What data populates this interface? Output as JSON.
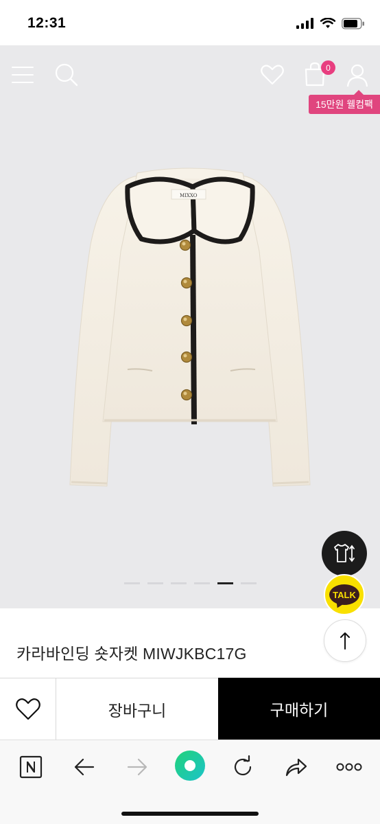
{
  "status_bar": {
    "time": "12:31"
  },
  "header": {
    "icons": [
      "menu-icon",
      "search-icon",
      "heart-icon",
      "shopping-bag-icon",
      "user-icon"
    ],
    "cart_count": "0",
    "welcome_tag": "15만원 웰컴팩"
  },
  "product": {
    "title": "카라바인딩 숏자켓 MIWJKBC17G",
    "image_label_brand": "MIXXO"
  },
  "pager": {
    "total": 6,
    "active_index": 5
  },
  "floating": {
    "closet_icon": "closet-icon",
    "talk_label": "TALK",
    "top_icon": "arrow-up-icon"
  },
  "actions": {
    "wish_icon": "heart-icon",
    "cart_label": "장바구니",
    "buy_label": "구매하기"
  },
  "browser": {
    "buttons": [
      "naver-n-icon",
      "back-icon",
      "forward-icon",
      "green-dot-icon",
      "refresh-icon",
      "share-icon",
      "more-icon"
    ]
  },
  "colors": {
    "accent_pink": "#e0457e",
    "badge_pink": "#e83e7f",
    "buy_bg": "#000000",
    "kakao_yellow": "#f9e000",
    "naver_green": "#2dcf8c"
  }
}
